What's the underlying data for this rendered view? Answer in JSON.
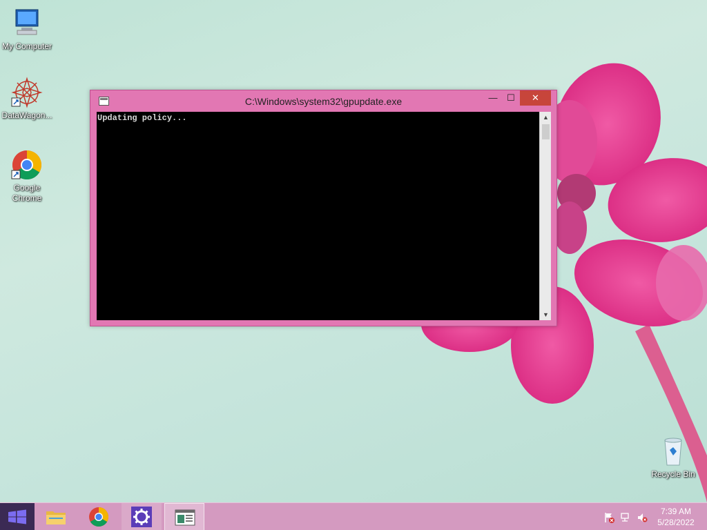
{
  "desktop": {
    "icons": [
      {
        "label": "My Computer"
      },
      {
        "label": "DataWagon..."
      },
      {
        "label": "Google Chrome"
      },
      {
        "label": "Recycle Bin"
      }
    ]
  },
  "window": {
    "title": "C:\\Windows\\system32\\gpupdate.exe",
    "minimize_glyph": "—",
    "maximize_glyph": "☐",
    "close_glyph": "✕",
    "console_text": "Updating policy...",
    "scroll_up_glyph": "▲",
    "scroll_down_glyph": "▼"
  },
  "taskbar": {
    "pinned": [
      {
        "icon": "file-explorer-icon"
      },
      {
        "icon": "chrome-icon"
      },
      {
        "icon": "settings-gear-icon"
      },
      {
        "icon": "console-window-icon",
        "active": true
      }
    ],
    "tray": {
      "icons": [
        "action-center-flag-icon",
        "network-icon",
        "volume-muted-icon"
      ],
      "time": "7:39 AM",
      "date": "5/28/2022"
    }
  },
  "colors": {
    "window_frame": "#e277b3",
    "close_button": "#c7453b",
    "taskbar": "#d49ac0"
  }
}
